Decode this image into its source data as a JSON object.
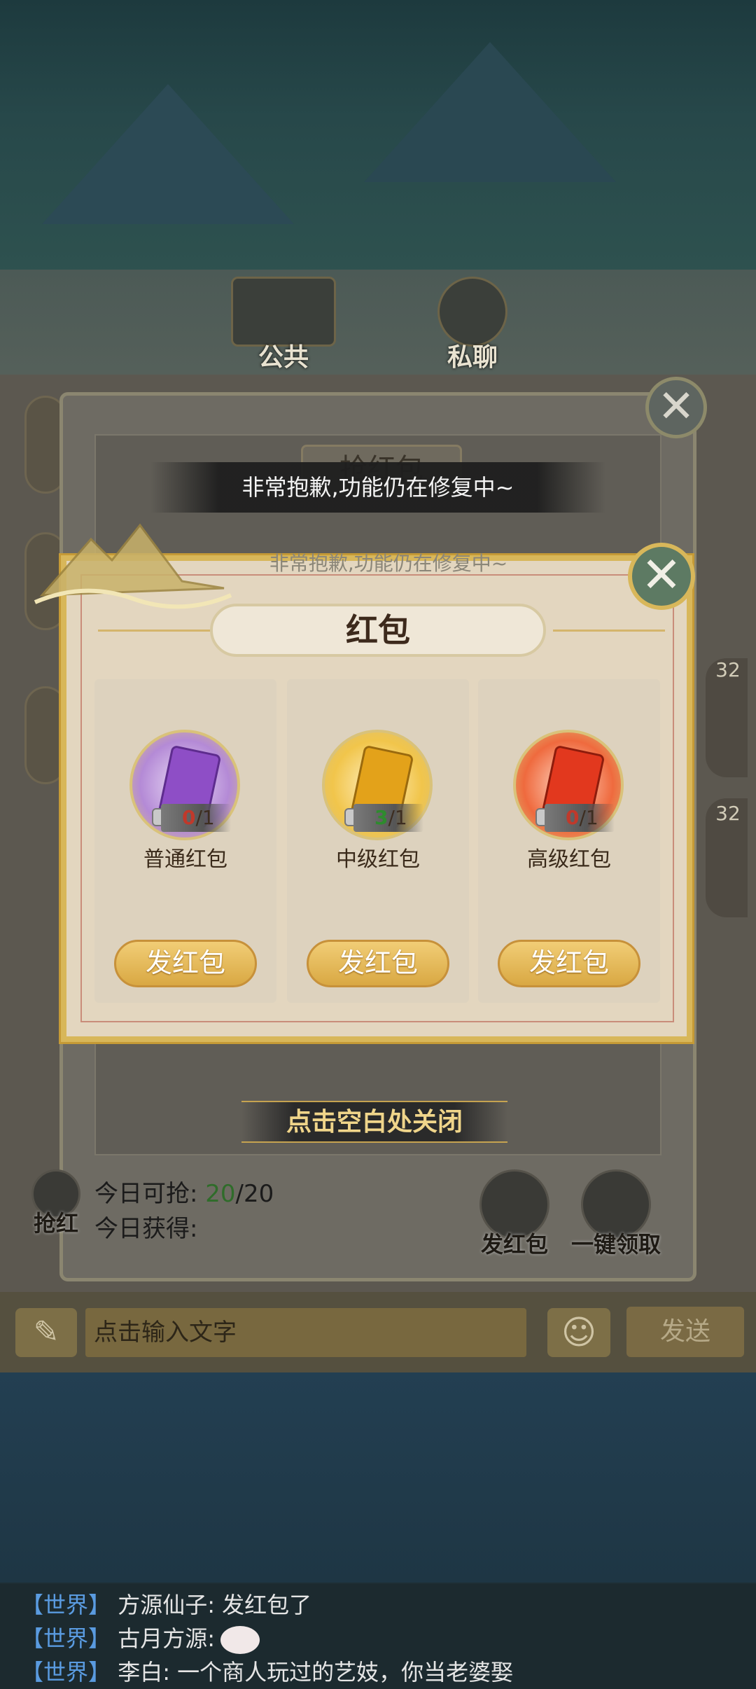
{
  "tabs": [
    {
      "label": "公共"
    },
    {
      "label": "私聊"
    }
  ],
  "panel": {
    "title": "抢红包",
    "close_icon": "close-icon"
  },
  "toast": {
    "message": "非常抱歉,功能仍在修复中~",
    "echo": "非常抱歉,功能仍在修复中~"
  },
  "levels": [
    "32",
    "32"
  ],
  "dialog": {
    "title": "红包",
    "close_icon": "close-icon",
    "cards": [
      {
        "name": "普通红包",
        "current": "0",
        "max": "/1",
        "current_color": "#c0392b",
        "button": "发红包",
        "envelope_color": "#8e4ec6"
      },
      {
        "name": "中级红包",
        "current": "3",
        "max": "/1",
        "current_color": "#2e8b2e",
        "button": "发红包",
        "envelope_color": "#e3a21a"
      },
      {
        "name": "高级红包",
        "current": "0",
        "max": "/1",
        "current_color": "#c0392b",
        "button": "发红包",
        "envelope_color": "#e2381e"
      }
    ]
  },
  "close_hint": "点击空白处关闭",
  "stats": {
    "can_grab_label": "今日可抢:",
    "can_grab_value": "20",
    "can_grab_total": "/20",
    "obtained_label": "今日获得:"
  },
  "actions": {
    "grab_label": "抢红",
    "send_label": "发红包",
    "collect_label": "一键领取"
  },
  "input": {
    "placeholder": "点击输入文字",
    "send_label": "发送"
  },
  "chat_log": [
    {
      "channel": "【世界】",
      "user": "方源仙子:",
      "message": "发红包了"
    },
    {
      "channel": "【世界】",
      "user": "古月方源:",
      "message": ""
    },
    {
      "channel": "【世界】",
      "user": "李白:",
      "message": "一个商人玩过的艺妓，你当老婆娶"
    }
  ],
  "colors": {
    "accent_gold": "#d8b75a",
    "world_channel": "#5a9be0",
    "grab_green": "#2f6c2a"
  }
}
